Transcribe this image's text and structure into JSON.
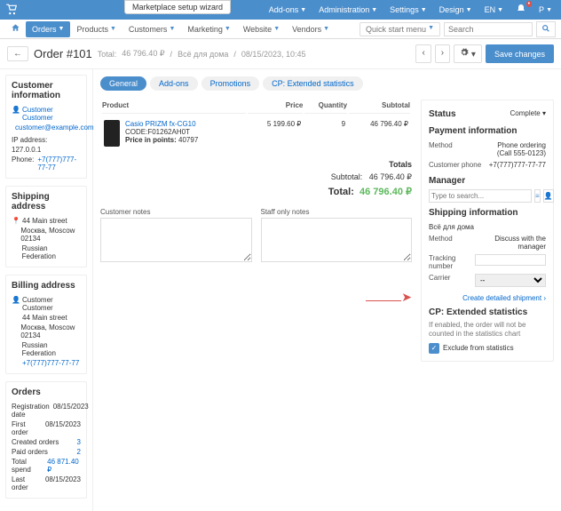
{
  "topbar": {
    "wizard": "Marketplace setup wizard",
    "menus": [
      "Add-ons",
      "Administration",
      "Settings",
      "Design",
      "EN"
    ],
    "user_initial": "P"
  },
  "nav": {
    "items": [
      "Orders",
      "Products",
      "Customers",
      "Marketing",
      "Website",
      "Vendors"
    ],
    "quick": "Quick start menu",
    "search_ph": "Search"
  },
  "title": {
    "order": "Order #101",
    "total_label": "Total:",
    "total_value": "46 796.40 ₽",
    "sep": "/",
    "channel": "Всё для дома",
    "timestamp": "08/15/2023, 10:45",
    "save": "Save changes"
  },
  "sidebar": {
    "cust": {
      "h": "Customer information",
      "name": "Customer Customer",
      "email": "customer@example.com",
      "ip_l": "IP address:",
      "ip": "127.0.0.1",
      "phone_l": "Phone:",
      "phone": "+7(777)777-77-77"
    },
    "ship": {
      "h": "Shipping address",
      "l1": "44 Main street",
      "l2": "Москва, Moscow 02134",
      "l3": "Russian Federation"
    },
    "bill": {
      "h": "Billing address",
      "name": "Customer Customer",
      "l1": "44 Main street",
      "l2": "Москва, Moscow 02134",
      "l3": "Russian Federation",
      "phone": "+7(777)777-77-77"
    },
    "orders": {
      "h": "Orders",
      "rows": [
        {
          "k": "Registration date",
          "v": "08/15/2023"
        },
        {
          "k": "First order",
          "v": "08/15/2023"
        },
        {
          "k": "Created orders",
          "v": "3"
        },
        {
          "k": "Paid orders",
          "v": "2"
        },
        {
          "k": "Total spend",
          "v": "46 871.40 ₽"
        },
        {
          "k": "Last order",
          "v": "08/15/2023"
        }
      ]
    }
  },
  "tabs": [
    "General",
    "Add-ons",
    "Promotions",
    "CP: Extended statistics"
  ],
  "ptable": {
    "cols": [
      "Product",
      "Price",
      "Quantity",
      "Subtotal"
    ],
    "name": "Casio PRIZM fx-CG10",
    "code_l": "CODE:",
    "code": "F01262AH0T",
    "pts_l": "Price in points:",
    "pts": "40797",
    "price": "5 199.60 ₽",
    "qty": "9",
    "sub": "46 796.40 ₽"
  },
  "totals": {
    "h": "Totals",
    "sub_l": "Subtotal:",
    "sub": "46 796.40 ₽",
    "tot_l": "Total:",
    "tot": "46 796.40 ₽"
  },
  "notes": {
    "cust": "Customer notes",
    "staff": "Staff only notes"
  },
  "rpanel": {
    "status_h": "Status",
    "status_v": "Complete",
    "pay_h": "Payment information",
    "method_l": "Method",
    "method_v": "Phone ordering (Call 555-0123)",
    "cphone_l": "Customer phone",
    "cphone_v": "+7(777)777-77-77",
    "mgr_h": "Manager",
    "mgr_ph": "Type to search...",
    "ship_h": "Shipping information",
    "ship_ch": "Всё для дома",
    "smethod_l": "Method",
    "smethod_v": "Discuss with the manager",
    "track_l": "Tracking number",
    "carrier_l": "Carrier",
    "carrier_v": "--",
    "create_link": "Create detailed shipment",
    "ext_h": "CP: Extended statistics",
    "ext_desc": "If enabled, the order will not be counted in the statistics chart",
    "exclude": "Exclude from statistics"
  }
}
